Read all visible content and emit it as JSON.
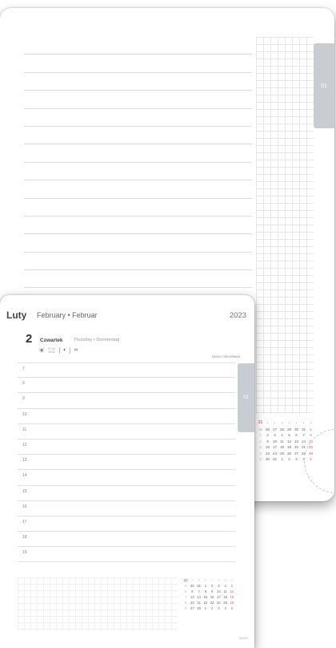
{
  "back_page": {
    "tab_label": "01",
    "calendar": {
      "week_number": "21",
      "rows": [
        [
          "25",
          "26",
          "27",
          "28",
          "29",
          "30",
          "31",
          "1"
        ],
        [
          "1",
          "2",
          "3",
          "4",
          "5",
          "6",
          "7",
          "8"
        ],
        [
          "2",
          "9",
          "10",
          "11",
          "12",
          "13",
          "14",
          "15"
        ],
        [
          "3",
          "16",
          "17",
          "18",
          "19",
          "20",
          "21",
          "22"
        ],
        [
          "4",
          "23",
          "24",
          "25",
          "26",
          "27",
          "28",
          "29"
        ],
        [
          "5",
          "30",
          "31",
          "1",
          "2",
          "3",
          "4",
          "5"
        ]
      ]
    }
  },
  "front_page": {
    "month_pl": "Luty",
    "month_en": "February • Februar",
    "year": "2023",
    "day_number": "2",
    "day_pl": "Czwartek",
    "day_en": "Thursday • Donnerstag",
    "sun_times": "07:18 16:34",
    "namedays": "Maria, Mirosława",
    "tab_label": "02",
    "hours": [
      "7",
      "8",
      "9",
      "10",
      "11",
      "12",
      "13",
      "14",
      "15",
      "16",
      "17",
      "18",
      "19"
    ],
    "calendar": {
      "week_number": "22",
      "rows": [
        [
          "5",
          "30",
          "31",
          "1",
          "2",
          "3",
          "4",
          "5"
        ],
        [
          "6",
          "6",
          "7",
          "8",
          "9",
          "10",
          "11",
          "12"
        ],
        [
          "7",
          "13",
          "14",
          "15",
          "16",
          "17",
          "18",
          "19"
        ],
        [
          "8",
          "20",
          "21",
          "22",
          "23",
          "24",
          "25",
          "26"
        ],
        [
          "9",
          "27",
          "28",
          "1",
          "2",
          "3",
          "4",
          "5"
        ]
      ]
    },
    "footer_code": "04-002"
  },
  "colors": {
    "tab": "#c8cdd4",
    "sunday_accent": "#e06070",
    "rule": "#e0e0e0"
  }
}
